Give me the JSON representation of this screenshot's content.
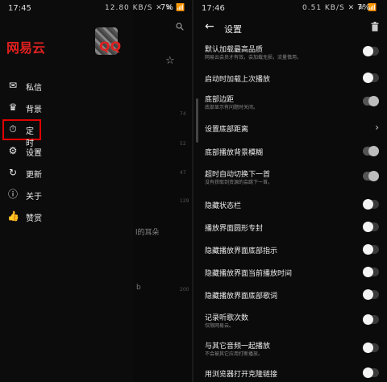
{
  "left": {
    "status": {
      "time": "17:45",
      "icons": "12.80 KB/S ✕ ≋ 📶",
      "battery": "7%"
    },
    "app_label": "网易云",
    "qq_label": "QQ",
    "menu": [
      {
        "icon": "mail-icon",
        "glyph": "✉",
        "label": "私信"
      },
      {
        "icon": "shirt-icon",
        "glyph": "♛",
        "label": "背景"
      },
      {
        "icon": "timer-icon",
        "glyph": "⏱",
        "label": "定时"
      },
      {
        "icon": "gear-icon",
        "glyph": "⚙",
        "label": "设置"
      },
      {
        "icon": "refresh-icon",
        "glyph": "↻",
        "label": "更新"
      },
      {
        "icon": "info-icon",
        "glyph": "ⓘ",
        "label": "关于"
      },
      {
        "icon": "thumbs-up-icon",
        "glyph": "👍",
        "label": "赞赏"
      }
    ],
    "ghost_text": "l的耳朵",
    "ghost_text2": "b",
    "axis_numbers": [
      "74",
      "52",
      "47",
      "129",
      "200"
    ]
  },
  "right": {
    "status": {
      "time": "17:46",
      "icons": "0.51 KB/S ✕ ≋ 📶",
      "battery": "7%"
    },
    "title": "设置",
    "rows": [
      {
        "title": "默认加载最高品质",
        "sub": "网易云会员才有效，会加载无损，流量慎用。",
        "control": "toggle",
        "state": "off"
      },
      {
        "title": "启动时加载上次播放",
        "sub": "",
        "control": "toggle",
        "state": "off"
      },
      {
        "title": "底部边距",
        "sub": "底部显示有问题时关闭。",
        "control": "toggle",
        "state": "on"
      },
      {
        "title": "设置底部距离",
        "sub": "",
        "control": "chevron",
        "state": ""
      },
      {
        "title": "底部播放背景模糊",
        "sub": "",
        "control": "toggle",
        "state": "on"
      },
      {
        "title": "超时自动切换下一首",
        "sub": "没有获取到资源的会跳下一首。",
        "control": "toggle",
        "state": "on"
      },
      {
        "title": "隐藏状态栏",
        "sub": "",
        "control": "toggle",
        "state": "off"
      },
      {
        "title": "播放界面圆形专封",
        "sub": "",
        "control": "toggle",
        "state": "off"
      },
      {
        "title": "隐藏播放界面底部指示",
        "sub": "",
        "control": "toggle",
        "state": "off"
      },
      {
        "title": "隐藏播放界面当前播放时间",
        "sub": "",
        "control": "toggle",
        "state": "off"
      },
      {
        "title": "隐藏播放界面底部歌词",
        "sub": "",
        "control": "toggle",
        "state": "off"
      },
      {
        "title": "记录听歌次数",
        "sub": "仅限网易云。",
        "control": "toggle",
        "state": "off"
      },
      {
        "title": "与其它音频一起播放",
        "sub": "不会被其它应用打断播放。",
        "control": "toggle",
        "state": "off"
      },
      {
        "title": "用浏览器打开克隆链接",
        "sub": "",
        "control": "toggle",
        "state": "off"
      }
    ]
  },
  "colors": {
    "highlight": "#e00000",
    "app_label": "#e02020"
  }
}
